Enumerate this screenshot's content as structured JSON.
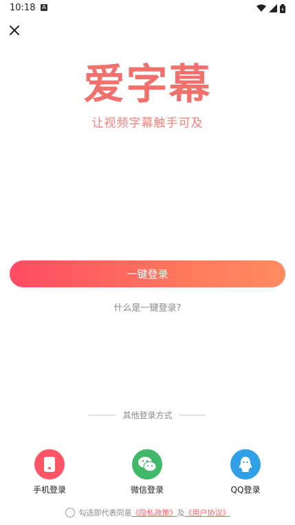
{
  "status_bar": {
    "time": "10:18",
    "notification_badge": "A",
    "icons": [
      "wifi-icon",
      "signal-icon",
      "battery-icon"
    ]
  },
  "header": {
    "close_icon": "close-icon"
  },
  "brand": {
    "logo_text": "爱字幕",
    "slogan": "让视频字幕触手可及",
    "color": "#f0716c"
  },
  "main": {
    "primary_button": "一键登录",
    "help_link": "什么是一键登录?"
  },
  "other_login": {
    "title": "其他登录方式",
    "options": [
      {
        "label": "手机登录",
        "icon": "phone-icon",
        "color": "#ff5566"
      },
      {
        "label": "微信登录",
        "icon": "wechat-icon",
        "color": "#42b86b"
      },
      {
        "label": "QQ登录",
        "icon": "qq-icon",
        "color": "#2fa0e6"
      }
    ]
  },
  "agreement": {
    "prefix": "勾选即代表同意",
    "privacy": "《隐私政策》",
    "and": "及",
    "terms": "《用户协议》"
  },
  "colors": {
    "gradient_start": "#ff4a63",
    "gradient_end": "#ff8b60",
    "link": "#ff5a66"
  }
}
